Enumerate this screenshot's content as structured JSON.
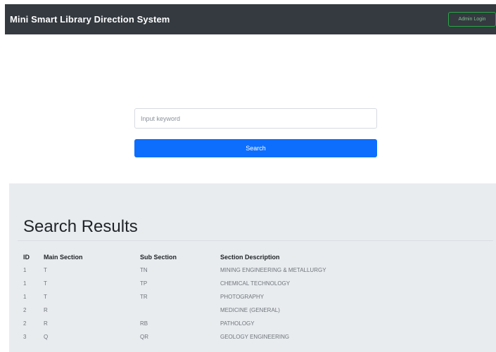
{
  "navbar": {
    "title": "Mini Smart Library Direction System",
    "admin_button": "Admin Login",
    "background": "#343a40"
  },
  "search": {
    "placeholder": "Input keyword",
    "button_label": "Search",
    "button_color": "#0d6efd"
  },
  "results": {
    "title": "Search Results",
    "headers": [
      "ID",
      "Main Section",
      "Sub Section",
      "Section Description"
    ],
    "rows": [
      [
        "1",
        "T",
        "TN",
        "MINING ENGINEERING & METALLURGY"
      ],
      [
        "1",
        "T",
        "TP",
        "CHEMICAL TECHNOLOGY"
      ],
      [
        "1",
        "T",
        "TR",
        "PHOTOGRAPHY"
      ],
      [
        "2",
        "R",
        "",
        "MEDICINE (GENERAL)"
      ],
      [
        "2",
        "R",
        "RB",
        "PATHOLOGY"
      ],
      [
        "3",
        "Q",
        "QR",
        "GEOLOGY ENGINEERING"
      ]
    ],
    "background": "#e9ecef"
  }
}
